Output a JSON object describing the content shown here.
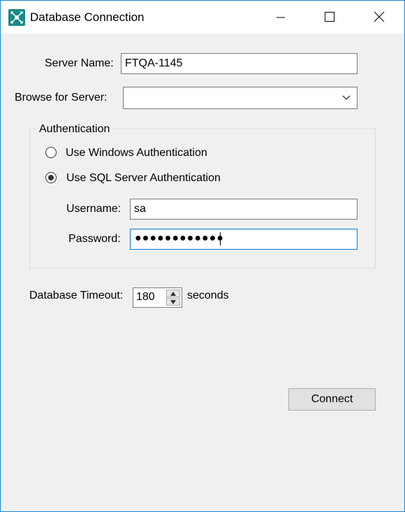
{
  "window": {
    "title": "Database Connection",
    "icon": "network-nodes-icon",
    "controls": [
      "minimize-icon",
      "maximize-icon",
      "close-icon"
    ]
  },
  "server": {
    "label": "Server Name:",
    "value": "FTQA-1145"
  },
  "browse": {
    "label": "Browse for Server:",
    "selected": ""
  },
  "authentication": {
    "legend": "Authentication",
    "options": [
      {
        "label": "Use Windows Authentication",
        "selected": false
      },
      {
        "label": "Use SQL Server Authentication",
        "selected": true
      }
    ],
    "username_label": "Username:",
    "username_value": "sa",
    "password_label": "Password:",
    "password_masked": "●●●●●●●●●●●●"
  },
  "timeout": {
    "label": "Database Timeout:",
    "value": "180",
    "unit": "seconds"
  },
  "connect_label": "Connect",
  "colors": {
    "window_border": "#1883d7",
    "focus_border": "#0078d7",
    "icon_teal": "#1a8a8a"
  }
}
